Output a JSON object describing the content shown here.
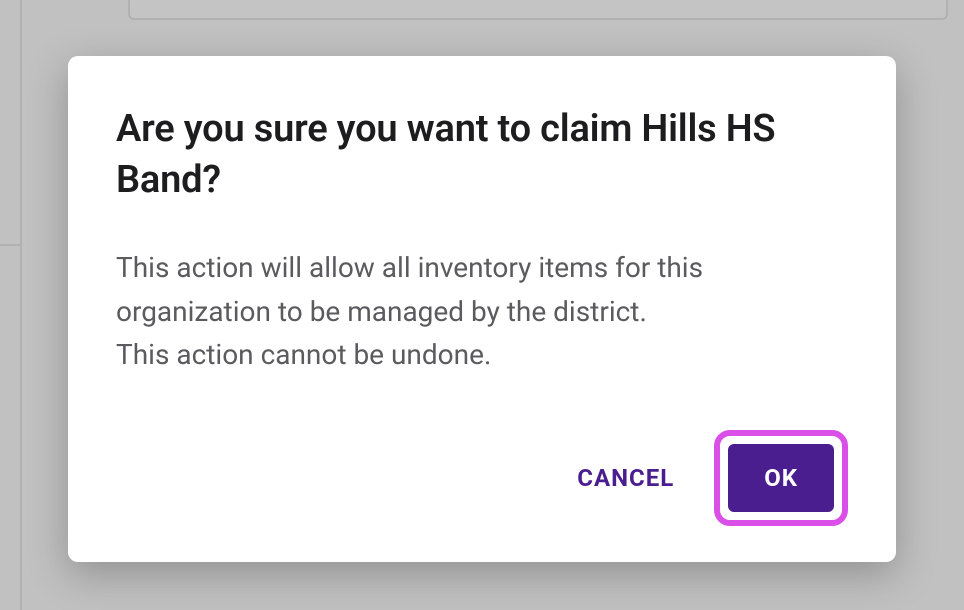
{
  "dialog": {
    "title": "Are you sure you want to claim Hills HS Band?",
    "body_line1": "This action will allow all inventory items for this organization to be managed by the district.",
    "body_line2": "This action cannot be undone.",
    "cancel_label": "CANCEL",
    "ok_label": "OK"
  },
  "colors": {
    "primary": "#4b1e90",
    "highlight": "#d94fe8"
  }
}
